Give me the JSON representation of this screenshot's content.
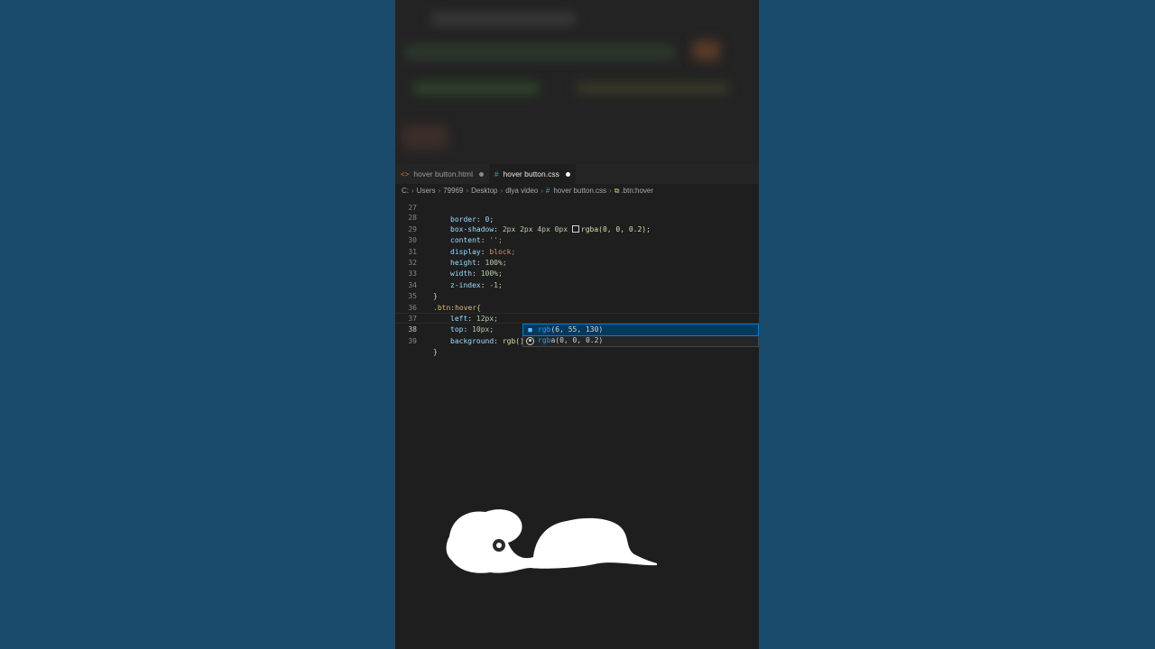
{
  "tabs": [
    {
      "icon": "<>",
      "label": "hover button.html",
      "active": false,
      "dot_color": "#8a8a8a"
    },
    {
      "icon": "#",
      "label": "hover button.css",
      "active": true,
      "dot_color": "#ffffff"
    }
  ],
  "breadcrumb": {
    "parts": [
      "C:",
      "Users",
      "79969",
      "Desktop",
      "dlya video"
    ],
    "file_icon": "#",
    "file": "hover button.css",
    "symbol_icon": "symbol-class-icon",
    "symbol": ".btn:hover"
  },
  "editor": {
    "lines": [
      {
        "num": "27",
        "text": "border: 0;"
      },
      {
        "num": "28",
        "prop": "box-shadow",
        "value": "2px 2px 4px 0px ",
        "fn": "rgba(0, 0, 0.2);"
      },
      {
        "num": "29",
        "prop": "content",
        "value": "'';"
      },
      {
        "num": "30",
        "prop": "display",
        "value": "block;"
      },
      {
        "num": "31",
        "prop": "height",
        "value": "100%;"
      },
      {
        "num": "32",
        "prop": "width",
        "value": "100%;"
      },
      {
        "num": "33",
        "prop": "z-index",
        "value": "-1;"
      },
      {
        "num": "34",
        "text": "}"
      },
      {
        "num": "35",
        "text": ".btn:hover{"
      },
      {
        "num": "36",
        "prop": "left",
        "value": "12px;"
      },
      {
        "num": "37",
        "prop": "top",
        "value": "10px;"
      },
      {
        "num": "38",
        "prop": "background",
        "value": "rgb();"
      },
      {
        "num": "39",
        "text": "}"
      }
    ],
    "current_line": "38"
  },
  "suggestions": [
    {
      "prefix": "rgb",
      "rest": "(6, 55, 130)",
      "icon": "color-swatch-icon",
      "selected": true
    },
    {
      "prefix": "rgb",
      "rest": "a(0, 0, 0.2)",
      "icon": "color-palette-icon",
      "selected": false
    }
  ]
}
